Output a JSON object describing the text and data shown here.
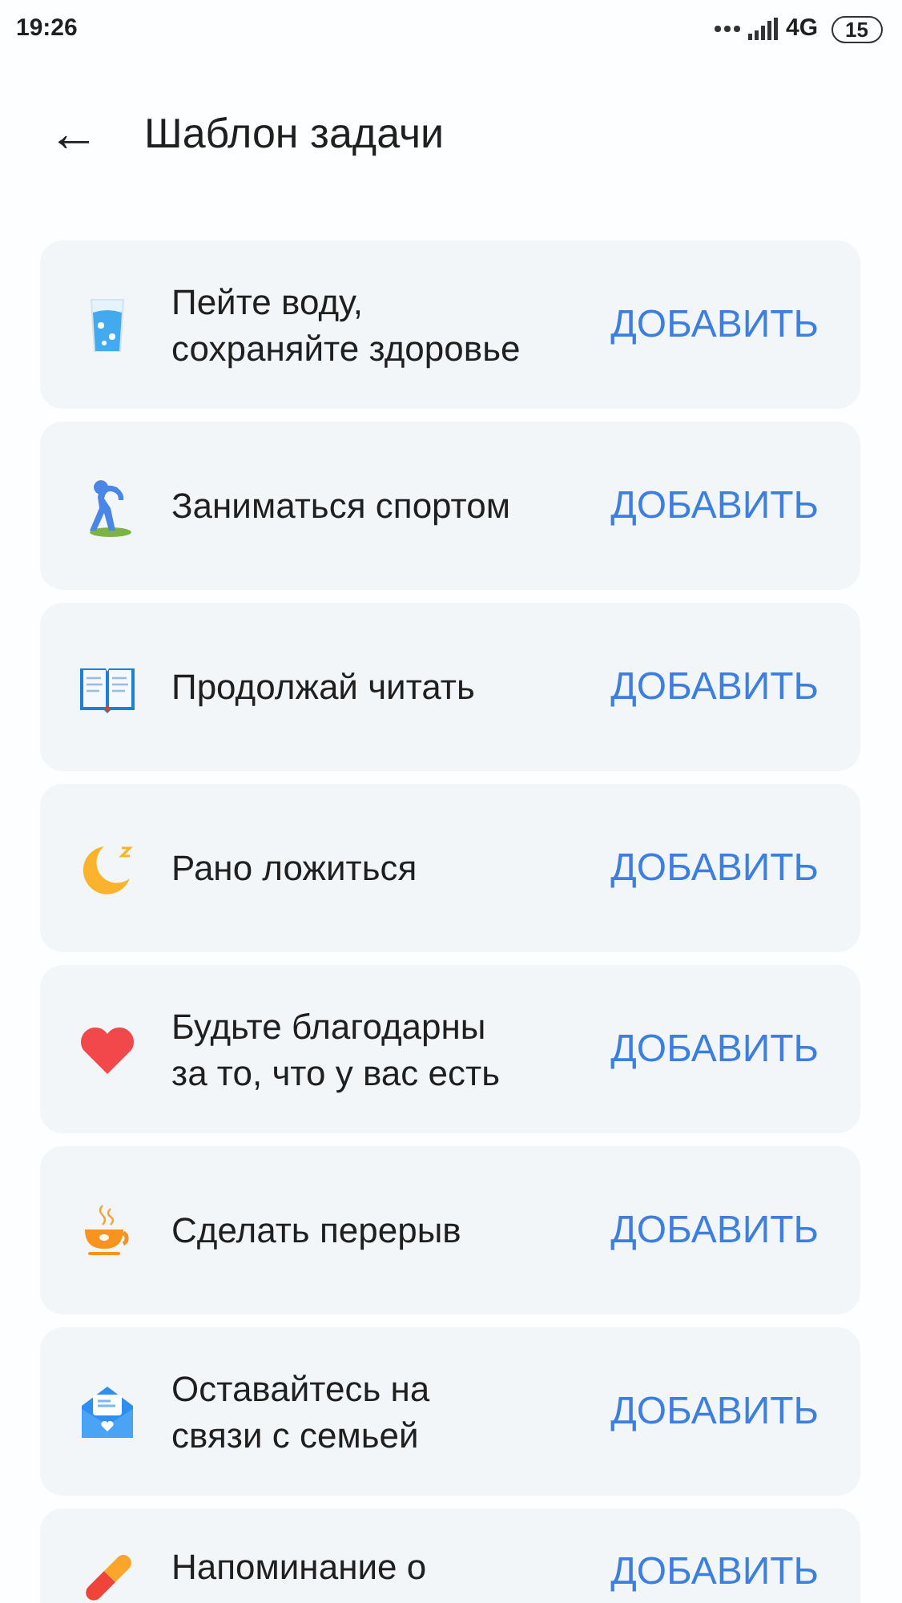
{
  "status_bar": {
    "time": "19:26",
    "network": "4G",
    "battery": "15"
  },
  "header": {
    "back": "←",
    "title": "Шаблон задачи"
  },
  "templates": [
    {
      "lines": [
        "Пейте воду,",
        "сохраняйте здоровье"
      ],
      "action": "ДОБАВИТЬ"
    },
    {
      "lines": [
        "Заниматься спортом"
      ],
      "action": "ДОБАВИТЬ"
    },
    {
      "lines": [
        "Продолжай читать"
      ],
      "action": "ДОБАВИТЬ"
    },
    {
      "lines": [
        "Рано ложиться"
      ],
      "action": "ДОБАВИТЬ"
    },
    {
      "lines": [
        "Будьте благодарны",
        "за то, что у вас есть"
      ],
      "action": "ДОБАВИТЬ"
    },
    {
      "lines": [
        "Сделать перерыв"
      ],
      "action": "ДОБАВИТЬ"
    },
    {
      "lines": [
        "Оставайтесь на",
        "связи с семьей"
      ],
      "action": "ДОБАВИТЬ"
    },
    {
      "lines": [
        "Напоминание о"
      ],
      "action": "ДОБАВИТЬ"
    }
  ]
}
